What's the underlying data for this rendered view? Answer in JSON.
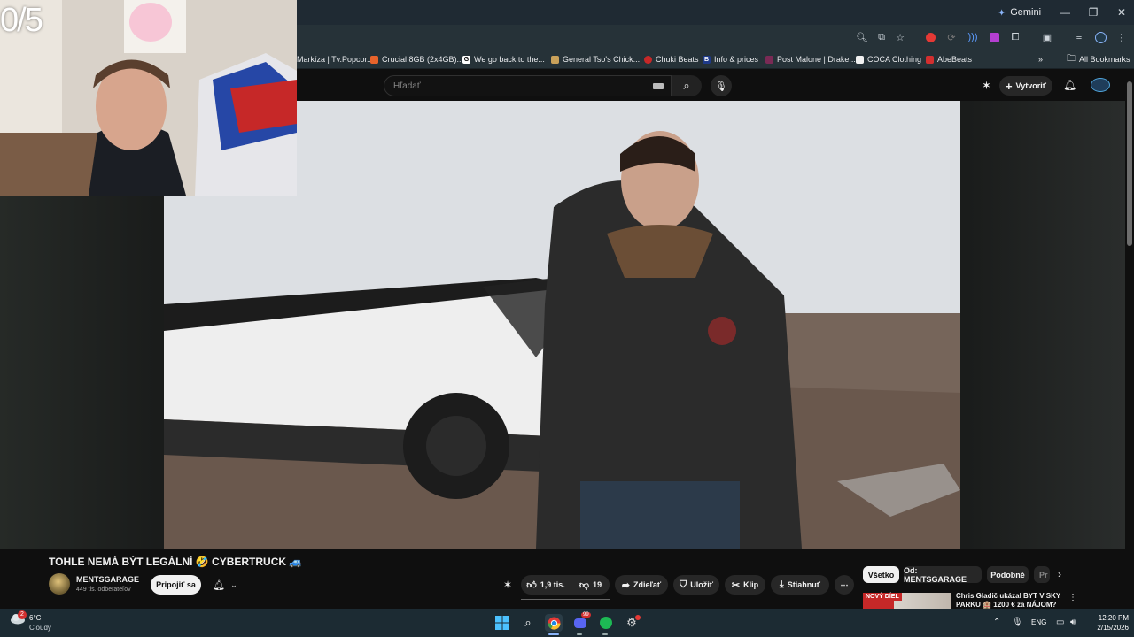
{
  "browser": {
    "gemini_label": "Gemini",
    "window_controls": [
      "—",
      "❐",
      "✕"
    ],
    "bookmarks": [
      {
        "label": "Markíza | Tv.Popcor...",
        "color": "#3a3a3a"
      },
      {
        "label": "Crucial 8GB (2x4GB)...",
        "color": "#e8632b"
      },
      {
        "label": "We go back to the...",
        "color": "#ffffff"
      },
      {
        "label": "General Tso's Chick...",
        "color": "#c9a15a"
      },
      {
        "label": "Chuki Beats",
        "color": "#c62828"
      },
      {
        "label": "Info & prices",
        "color": "#1e3a8a"
      },
      {
        "label": "Post Malone | Drake...",
        "color": "#7a2a55"
      },
      {
        "label": "COCA Clothing",
        "color": "#f1f1f1"
      },
      {
        "label": "AbeBeats",
        "color": "#d32f2f"
      }
    ],
    "all_bookmarks": "All Bookmarks"
  },
  "youtube": {
    "search_placeholder": "Hľadať",
    "create_label": "Vytvoriť"
  },
  "overlay": {
    "counter": "0/5"
  },
  "video": {
    "title": "TOHLE NEMÁ BÝT LEGÁLNÍ 🤣 CYBERTRUCK 🚙",
    "channel": "MENTSGARAGE",
    "subscribers": "449 tis. odberateľov",
    "subscribe_label": "Pripojiť sa",
    "likes": "1,9 tis.",
    "dislikes": "19",
    "share": "Zdieľať",
    "save": "Uložiť",
    "clip": "Klip",
    "download": "Stiahnuť"
  },
  "chips": [
    "Všetko",
    "Od: MENTSGARAGE",
    "Podobné",
    "Pr"
  ],
  "recommendation": {
    "badge": "NOVÝ DÍEL",
    "title": "Chris Gladič ukázal BYT V SKY PARKU 🏨 1200 € za NÁJOM?"
  },
  "taskbar": {
    "temperature": "6°C",
    "condition": "Cloudy",
    "weather_badge": "2",
    "discord_badge": "99",
    "language": "ENG",
    "time": "12:20 PM",
    "date": "2/15/2026"
  }
}
